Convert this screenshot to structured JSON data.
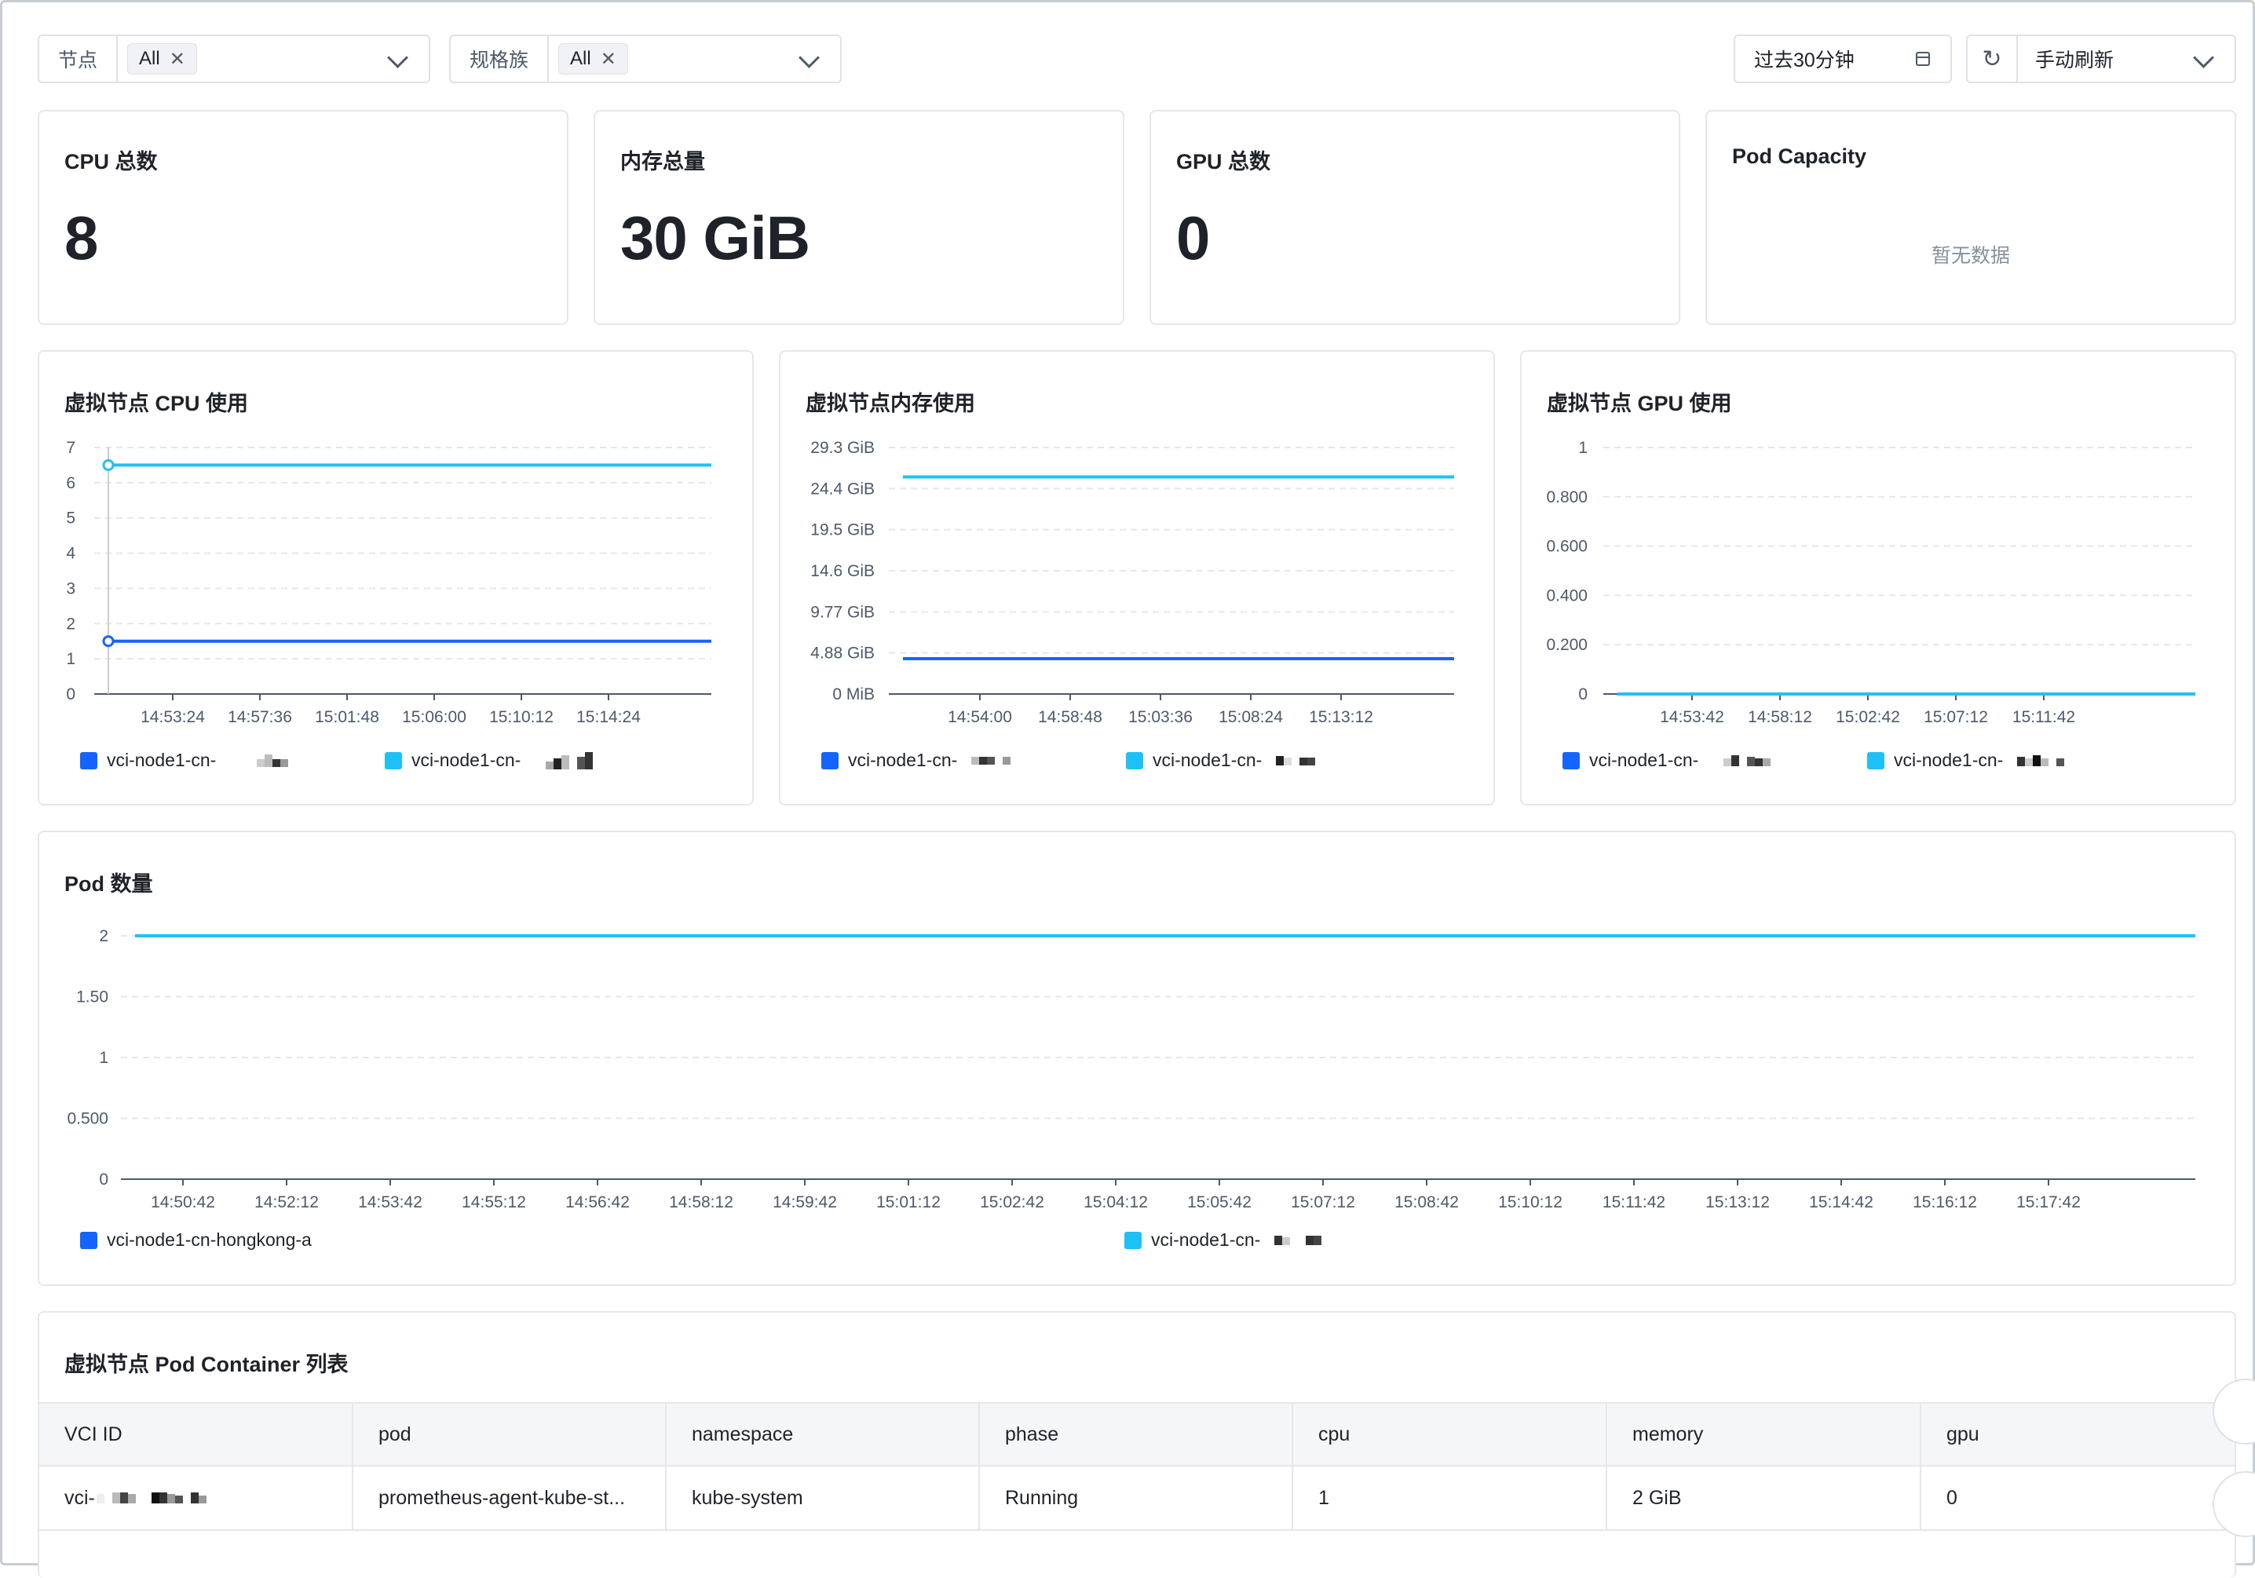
{
  "filters": {
    "node": {
      "label": "节点",
      "tag": "All"
    },
    "spec_family": {
      "label": "规格族",
      "tag": "All"
    },
    "time_range": "过去30分钟",
    "refresh_mode": "手动刷新"
  },
  "stats": [
    {
      "title": "CPU 总数",
      "value": "8"
    },
    {
      "title": "内存总量",
      "value": "30 GiB"
    },
    {
      "title": "GPU 总数",
      "value": "0"
    },
    {
      "title": "Pod Capacity",
      "value": "",
      "empty_text": "暂无数据"
    }
  ],
  "colors": {
    "series_a": "#1664ff",
    "series_b": "#1ec1f5",
    "grid": "#e4e7ec"
  },
  "chart_data": [
    {
      "type": "line",
      "title": "虚拟节点 CPU 使用",
      "x": [
        "14:53:24",
        "14:57:36",
        "15:01:48",
        "15:06:00",
        "15:10:12",
        "15:14:24"
      ],
      "y_ticks": [
        "0",
        "1",
        "2",
        "3",
        "4",
        "5",
        "6",
        "7"
      ],
      "ylim": [
        0,
        7
      ],
      "series": [
        {
          "name": "vci-node1-cn-",
          "color": "#1664ff",
          "values": [
            1.5,
            1.5,
            1.5,
            1.5,
            1.5,
            1.5,
            1.5
          ]
        },
        {
          "name": "vci-node1-cn-",
          "color": "#1ec1f5",
          "values": [
            6.5,
            6.5,
            6.5,
            6.5,
            6.5,
            6.5,
            6.5
          ]
        }
      ]
    },
    {
      "type": "line",
      "title": "虚拟节点内存使用",
      "x": [
        "14:54:00",
        "14:58:48",
        "15:03:36",
        "15:08:24",
        "15:13:12"
      ],
      "y_ticks": [
        "0  MiB",
        "4.88  GiB",
        "9.77  GiB",
        "14.6  GiB",
        "19.5  GiB",
        "24.4  GiB",
        "29.3  GiB"
      ],
      "ylim": [
        0,
        29.3
      ],
      "series": [
        {
          "name": "vci-node1-cn-",
          "color": "#1664ff",
          "values": [
            4.2,
            4.2,
            4.2,
            4.2,
            4.2,
            4.2
          ]
        },
        {
          "name": "vci-node1-cn-",
          "color": "#1ec1f5",
          "values": [
            25.8,
            25.8,
            25.8,
            25.8,
            25.8,
            25.8
          ]
        }
      ]
    },
    {
      "type": "line",
      "title": "虚拟节点 GPU 使用",
      "x": [
        "14:53:42",
        "14:58:12",
        "15:02:42",
        "15:07:12",
        "15:11:42"
      ],
      "y_ticks": [
        "0",
        "0.200",
        "0.400",
        "0.600",
        "0.800",
        "1"
      ],
      "ylim": [
        0,
        1
      ],
      "series": [
        {
          "name": "vci-node1-cn-",
          "color": "#1664ff",
          "values": [
            0,
            0,
            0,
            0,
            0,
            0
          ]
        },
        {
          "name": "vci-node1-cn-",
          "color": "#1ec1f5",
          "values": [
            0,
            0,
            0,
            0,
            0,
            0
          ]
        }
      ]
    },
    {
      "type": "line",
      "title": "Pod 数量",
      "x": [
        "14:50:42",
        "14:52:12",
        "14:53:42",
        "14:55:12",
        "14:56:42",
        "14:58:12",
        "14:59:42",
        "15:01:12",
        "15:02:42",
        "15:04:12",
        "15:05:42",
        "15:07:12",
        "15:08:42",
        "15:10:12",
        "15:11:42",
        "15:13:12",
        "15:14:42",
        "15:16:12",
        "15:17:42"
      ],
      "y_ticks": [
        "0",
        "0.500",
        "1",
        "1.50",
        "2"
      ],
      "ylim": [
        0,
        2
      ],
      "series": [
        {
          "name": "vci-node1-cn-hongkong-a",
          "color": "#1664ff",
          "values": [
            2,
            2,
            2,
            2,
            2,
            2,
            2,
            2,
            2,
            2,
            2,
            2,
            2,
            2,
            2,
            2,
            2,
            2,
            2,
            2
          ]
        },
        {
          "name": "vci-node1-cn-",
          "color": "#1ec1f5",
          "values": [
            2,
            2,
            2,
            2,
            2,
            2,
            2,
            2,
            2,
            2,
            2,
            2,
            2,
            2,
            2,
            2,
            2,
            2,
            2,
            2
          ]
        }
      ]
    }
  ],
  "table": {
    "title": "虚拟节点 Pod Container 列表",
    "columns": [
      "VCI ID",
      "pod",
      "namespace",
      "phase",
      "cpu",
      "memory",
      "gpu"
    ],
    "rows": [
      [
        "vci-",
        "prometheus-agent-kube-st...",
        "kube-system",
        "Running",
        "1",
        "2 GiB",
        "0"
      ]
    ]
  }
}
